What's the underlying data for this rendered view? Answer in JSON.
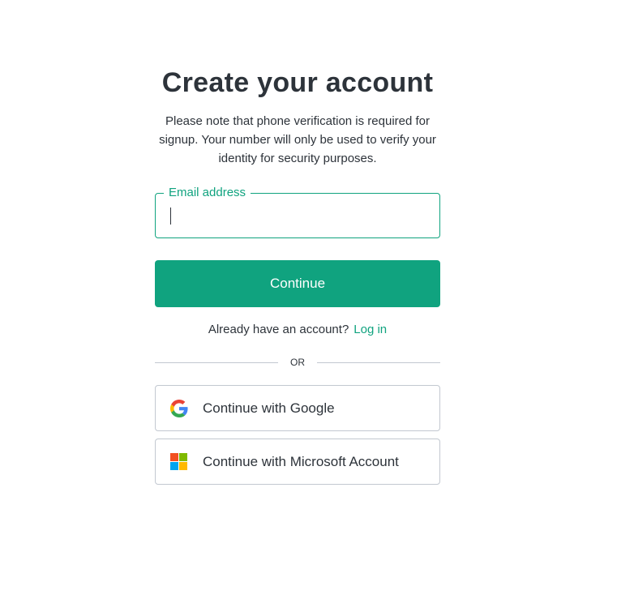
{
  "title": "Create your account",
  "subtitle": "Please note that phone verification is required for signup. Your number will only be used to verify your identity for security purposes.",
  "email_field": {
    "label": "Email address",
    "value": "",
    "focused": true
  },
  "continue_button": {
    "label": "Continue"
  },
  "login_prompt": {
    "text": "Already have an account?",
    "link_label": "Log in"
  },
  "divider": {
    "text": "OR"
  },
  "social_buttons": [
    {
      "provider": "google",
      "label": "Continue with Google",
      "icon": "google-icon"
    },
    {
      "provider": "microsoft",
      "label": "Continue with Microsoft Account",
      "icon": "microsoft-icon"
    }
  ],
  "colors": {
    "accent": "#10a37f",
    "text": "#2d333a",
    "border": "#c2c8d0",
    "microsoft_red": "#f25022",
    "microsoft_green": "#7fba00",
    "microsoft_blue": "#00a4ef",
    "microsoft_yellow": "#ffb900",
    "google_blue": "#4285f4",
    "google_red": "#ea4335",
    "google_yellow": "#fbbc05",
    "google_green": "#34a853"
  }
}
